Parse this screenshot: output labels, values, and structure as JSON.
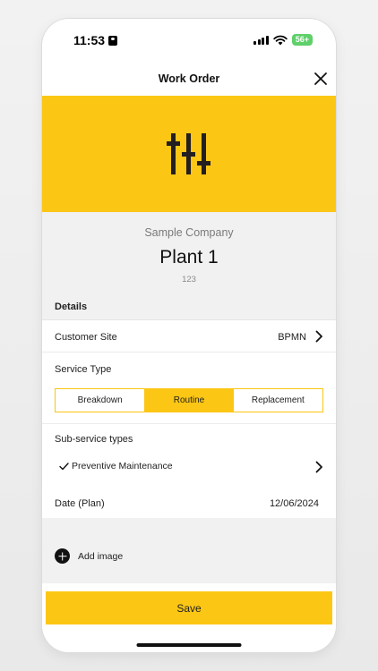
{
  "status_bar": {
    "time": "11:53",
    "battery": "56+"
  },
  "nav": {
    "title": "Work Order"
  },
  "header": {
    "company": "Sample Company",
    "plant": "Plant 1",
    "code": "123"
  },
  "details": {
    "section_title": "Details",
    "customer_site": {
      "label": "Customer Site",
      "value": "BPMN"
    },
    "service_type": {
      "label": "Service Type",
      "options": [
        "Breakdown",
        "Routine",
        "Replacement"
      ],
      "selected": "Routine"
    },
    "sub_service": {
      "label": "Sub-service types",
      "selected": "Preventive Maintenance"
    },
    "date_plan": {
      "label": "Date (Plan)",
      "value": "12/06/2024"
    }
  },
  "add_image": {
    "label": "Add image"
  },
  "save": {
    "label": "Save"
  },
  "colors": {
    "accent": "#fcc615"
  },
  "icons": {
    "hero": "sliders-icon",
    "close": "close-icon"
  }
}
